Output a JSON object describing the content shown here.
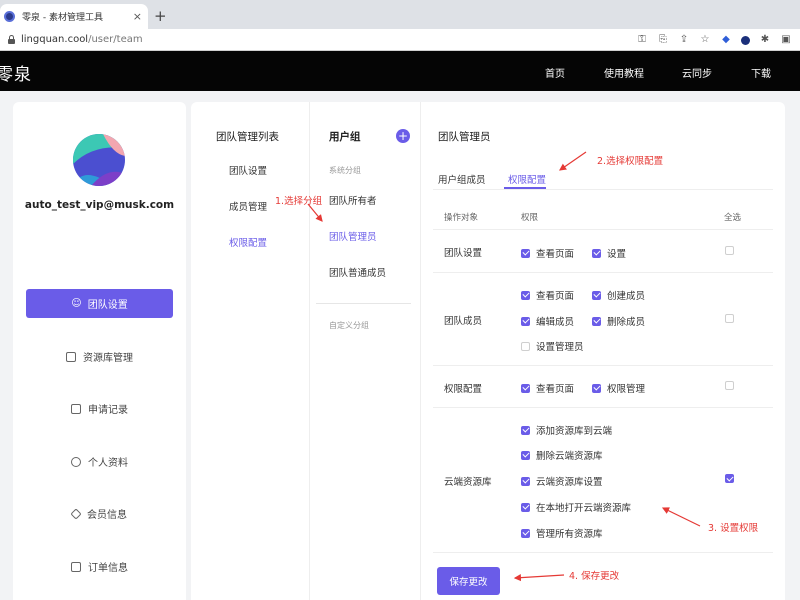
{
  "browser": {
    "tab_title": "零泉 - 素材管理工具",
    "tab_close": "×",
    "new_tab": "+",
    "url_host": "lingquan.cool",
    "url_path": "/user/team",
    "toolbar_icons": [
      "key-icon",
      "translate-icon",
      "share-icon",
      "star-icon",
      "extension-icon",
      "profile-icon",
      "puzzle-icon",
      "sidebar-icon"
    ]
  },
  "site": {
    "logo": "零泉",
    "nav": [
      "首页",
      "使用教程",
      "云同步",
      "下载"
    ]
  },
  "sidebar": {
    "email": "auto_test_vip@musk.com",
    "active_item": "团队设置",
    "items": [
      "资源库管理",
      "申请记录",
      "个人资料",
      "会员信息",
      "订单信息"
    ]
  },
  "team_list": {
    "title": "团队管理列表",
    "items": [
      "团队设置",
      "成员管理",
      "权限配置"
    ],
    "active_index": 2
  },
  "user_groups": {
    "title": "用户组",
    "add_label": "+",
    "system_section": "系统分组",
    "items": [
      "团队所有者",
      "团队管理员",
      "团队普通成员"
    ],
    "active_index": 1,
    "custom_section": "自定义分组"
  },
  "permissions": {
    "title": "团队管理员",
    "tabs": [
      "用户组成员",
      "权限配置"
    ],
    "active_tab": 1,
    "headers": {
      "target": "操作对象",
      "perm": "权限",
      "all": "全选"
    },
    "rows": [
      {
        "label": "团队设置",
        "perms": [
          {
            "name": "查看页面",
            "checked": true
          },
          {
            "name": "设置",
            "checked": true
          }
        ],
        "select_all": false
      },
      {
        "label": "团队成员",
        "perms": [
          {
            "name": "查看页面",
            "checked": true
          },
          {
            "name": "创建成员",
            "checked": true
          },
          {
            "name": "编辑成员",
            "checked": true
          },
          {
            "name": "删除成员",
            "checked": true
          },
          {
            "name": "设置管理员",
            "checked": false
          }
        ],
        "select_all": false
      },
      {
        "label": "权限配置",
        "perms": [
          {
            "name": "查看页面",
            "checked": true
          },
          {
            "name": "权限管理",
            "checked": true
          }
        ],
        "select_all": false
      },
      {
        "label": "云端资源库",
        "perms": [
          {
            "name": "添加资源库到云端",
            "checked": true
          },
          {
            "name": "删除云端资源库",
            "checked": true
          },
          {
            "name": "云端资源库设置",
            "checked": true
          },
          {
            "name": "在本地打开云端资源库",
            "checked": true
          },
          {
            "name": "管理所有资源库",
            "checked": true
          }
        ],
        "select_all": true
      }
    ],
    "save_label": "保存更改"
  },
  "annotations": {
    "step1": "1.选择分组",
    "step2": "2.选择权限配置",
    "step3": "3. 设置权限",
    "step4": "4. 保存更改",
    "color": "#e53935"
  },
  "colors": {
    "accent": "#6a5ce8",
    "header_bg": "#050505"
  }
}
